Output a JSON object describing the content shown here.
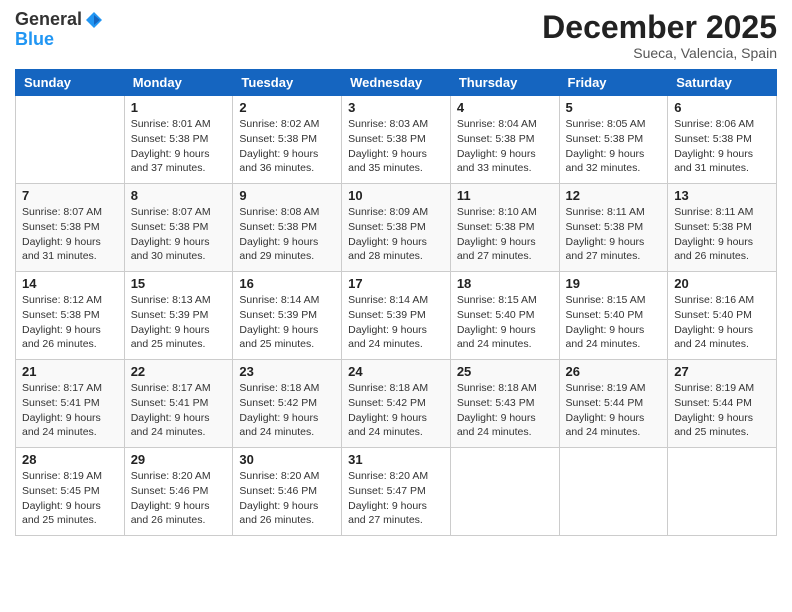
{
  "logo": {
    "general": "General",
    "blue": "Blue"
  },
  "title": "December 2025",
  "location": "Sueca, Valencia, Spain",
  "days_of_week": [
    "Sunday",
    "Monday",
    "Tuesday",
    "Wednesday",
    "Thursday",
    "Friday",
    "Saturday"
  ],
  "weeks": [
    [
      {
        "day": "",
        "info": ""
      },
      {
        "day": "1",
        "info": "Sunrise: 8:01 AM\nSunset: 5:38 PM\nDaylight: 9 hours\nand 37 minutes."
      },
      {
        "day": "2",
        "info": "Sunrise: 8:02 AM\nSunset: 5:38 PM\nDaylight: 9 hours\nand 36 minutes."
      },
      {
        "day": "3",
        "info": "Sunrise: 8:03 AM\nSunset: 5:38 PM\nDaylight: 9 hours\nand 35 minutes."
      },
      {
        "day": "4",
        "info": "Sunrise: 8:04 AM\nSunset: 5:38 PM\nDaylight: 9 hours\nand 33 minutes."
      },
      {
        "day": "5",
        "info": "Sunrise: 8:05 AM\nSunset: 5:38 PM\nDaylight: 9 hours\nand 32 minutes."
      },
      {
        "day": "6",
        "info": "Sunrise: 8:06 AM\nSunset: 5:38 PM\nDaylight: 9 hours\nand 31 minutes."
      }
    ],
    [
      {
        "day": "7",
        "info": "Sunrise: 8:07 AM\nSunset: 5:38 PM\nDaylight: 9 hours\nand 31 minutes."
      },
      {
        "day": "8",
        "info": "Sunrise: 8:07 AM\nSunset: 5:38 PM\nDaylight: 9 hours\nand 30 minutes."
      },
      {
        "day": "9",
        "info": "Sunrise: 8:08 AM\nSunset: 5:38 PM\nDaylight: 9 hours\nand 29 minutes."
      },
      {
        "day": "10",
        "info": "Sunrise: 8:09 AM\nSunset: 5:38 PM\nDaylight: 9 hours\nand 28 minutes."
      },
      {
        "day": "11",
        "info": "Sunrise: 8:10 AM\nSunset: 5:38 PM\nDaylight: 9 hours\nand 27 minutes."
      },
      {
        "day": "12",
        "info": "Sunrise: 8:11 AM\nSunset: 5:38 PM\nDaylight: 9 hours\nand 27 minutes."
      },
      {
        "day": "13",
        "info": "Sunrise: 8:11 AM\nSunset: 5:38 PM\nDaylight: 9 hours\nand 26 minutes."
      }
    ],
    [
      {
        "day": "14",
        "info": "Sunrise: 8:12 AM\nSunset: 5:38 PM\nDaylight: 9 hours\nand 26 minutes."
      },
      {
        "day": "15",
        "info": "Sunrise: 8:13 AM\nSunset: 5:39 PM\nDaylight: 9 hours\nand 25 minutes."
      },
      {
        "day": "16",
        "info": "Sunrise: 8:14 AM\nSunset: 5:39 PM\nDaylight: 9 hours\nand 25 minutes."
      },
      {
        "day": "17",
        "info": "Sunrise: 8:14 AM\nSunset: 5:39 PM\nDaylight: 9 hours\nand 24 minutes."
      },
      {
        "day": "18",
        "info": "Sunrise: 8:15 AM\nSunset: 5:40 PM\nDaylight: 9 hours\nand 24 minutes."
      },
      {
        "day": "19",
        "info": "Sunrise: 8:15 AM\nSunset: 5:40 PM\nDaylight: 9 hours\nand 24 minutes."
      },
      {
        "day": "20",
        "info": "Sunrise: 8:16 AM\nSunset: 5:40 PM\nDaylight: 9 hours\nand 24 minutes."
      }
    ],
    [
      {
        "day": "21",
        "info": "Sunrise: 8:17 AM\nSunset: 5:41 PM\nDaylight: 9 hours\nand 24 minutes."
      },
      {
        "day": "22",
        "info": "Sunrise: 8:17 AM\nSunset: 5:41 PM\nDaylight: 9 hours\nand 24 minutes."
      },
      {
        "day": "23",
        "info": "Sunrise: 8:18 AM\nSunset: 5:42 PM\nDaylight: 9 hours\nand 24 minutes."
      },
      {
        "day": "24",
        "info": "Sunrise: 8:18 AM\nSunset: 5:42 PM\nDaylight: 9 hours\nand 24 minutes."
      },
      {
        "day": "25",
        "info": "Sunrise: 8:18 AM\nSunset: 5:43 PM\nDaylight: 9 hours\nand 24 minutes."
      },
      {
        "day": "26",
        "info": "Sunrise: 8:19 AM\nSunset: 5:44 PM\nDaylight: 9 hours\nand 24 minutes."
      },
      {
        "day": "27",
        "info": "Sunrise: 8:19 AM\nSunset: 5:44 PM\nDaylight: 9 hours\nand 25 minutes."
      }
    ],
    [
      {
        "day": "28",
        "info": "Sunrise: 8:19 AM\nSunset: 5:45 PM\nDaylight: 9 hours\nand 25 minutes."
      },
      {
        "day": "29",
        "info": "Sunrise: 8:20 AM\nSunset: 5:46 PM\nDaylight: 9 hours\nand 26 minutes."
      },
      {
        "day": "30",
        "info": "Sunrise: 8:20 AM\nSunset: 5:46 PM\nDaylight: 9 hours\nand 26 minutes."
      },
      {
        "day": "31",
        "info": "Sunrise: 8:20 AM\nSunset: 5:47 PM\nDaylight: 9 hours\nand 27 minutes."
      },
      {
        "day": "",
        "info": ""
      },
      {
        "day": "",
        "info": ""
      },
      {
        "day": "",
        "info": ""
      }
    ]
  ]
}
